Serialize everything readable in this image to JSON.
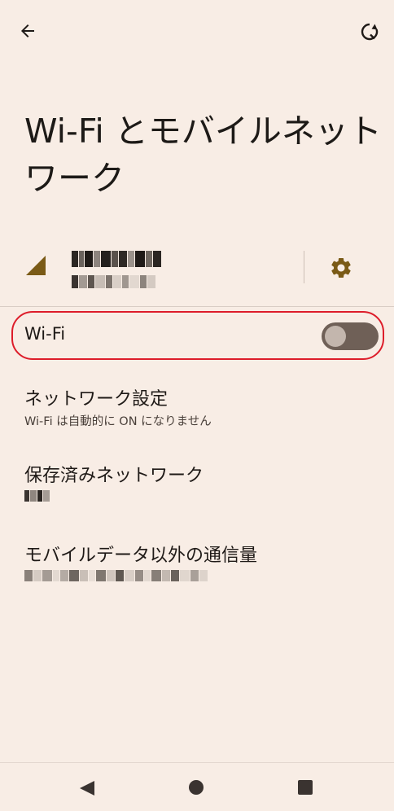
{
  "header": {
    "back_icon": "arrow-back-icon",
    "refresh_icon": "reset-refresh-icon",
    "title": "Wi-Fi とモバイルネットワーク"
  },
  "carrier": {
    "signal_icon": "cell-signal-icon",
    "settings_icon": "gear-icon",
    "accent_color": "#7a5a16"
  },
  "wifi": {
    "label": "Wi-Fi",
    "toggle_state": "off",
    "highlight_color": "#dd1d2a"
  },
  "items": [
    {
      "title": "ネットワーク設定",
      "subtitle": "Wi-Fi は自動的に ON になりません"
    },
    {
      "title": "保存済みネットワーク",
      "subtitle": ""
    },
    {
      "title": "モバイルデータ以外の通信量",
      "subtitle": ""
    }
  ],
  "nav": {
    "back_icon": "nav-back-triangle-icon",
    "home_icon": "nav-home-circle-icon",
    "recents_icon": "nav-recents-square-icon"
  }
}
